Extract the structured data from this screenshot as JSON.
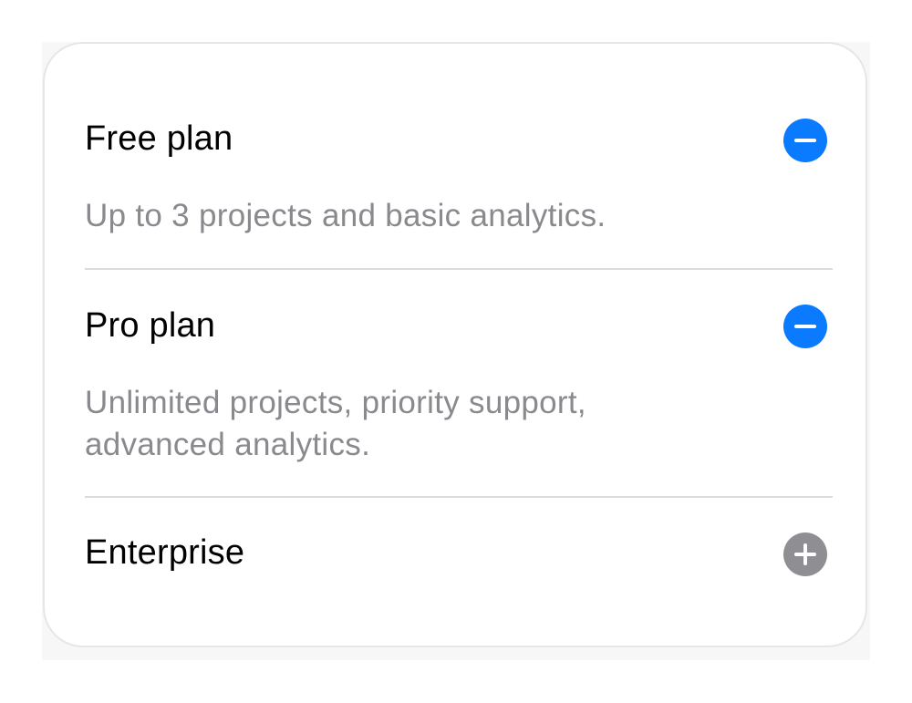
{
  "accordion": {
    "items": [
      {
        "title": "Free plan",
        "description": "Up to 3 projects and basic analytics.",
        "expanded": true,
        "toggle_icon": "minus-icon"
      },
      {
        "title": "Pro plan",
        "description": "Unlimited projects, priority support, advanced analytics.",
        "expanded": true,
        "toggle_icon": "minus-icon"
      },
      {
        "title": "Enterprise",
        "description": "",
        "expanded": false,
        "toggle_icon": "plus-icon"
      }
    ]
  },
  "colors": {
    "expanded_toggle": "#0a7aff",
    "collapsed_toggle": "#8e8e93",
    "title": "#000000",
    "description": "#8a8a8e",
    "divider": "#dcdcdc"
  }
}
